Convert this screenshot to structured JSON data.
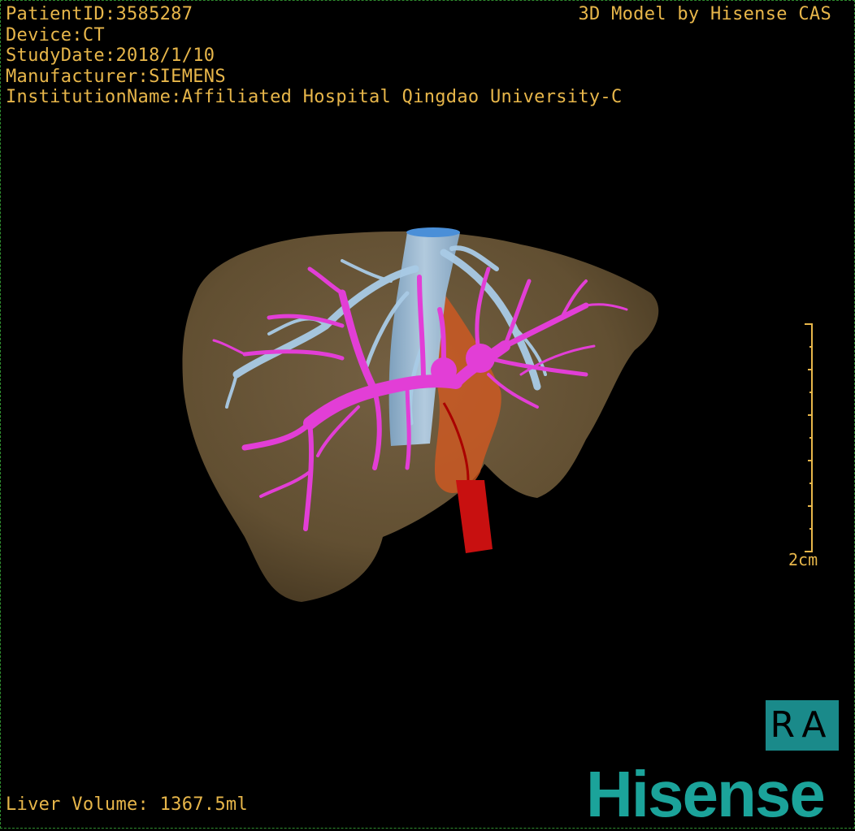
{
  "info": {
    "patient_id": "PatientID:3585287",
    "device": "Device:CT",
    "study_date": "StudyDate:2018/1/10",
    "manufacturer": "Manufacturer:SIEMENS",
    "institution": "InstitutionName:Affiliated Hospital Qingdao University-C"
  },
  "credit": "3D Model by Hisense CAS",
  "liver_volume": "Liver Volume: 1367.5ml",
  "scale_bar": {
    "label": "2cm"
  },
  "orientation_label": "RA",
  "logo_text": "Hisense",
  "colors": {
    "text": "#e7b64a",
    "liver": "#6e5a3c",
    "portal_vein": "#e040d8",
    "hepatic_vein": "#9ec6e6",
    "artery": "#c81010",
    "brand": "#1ba39a"
  }
}
